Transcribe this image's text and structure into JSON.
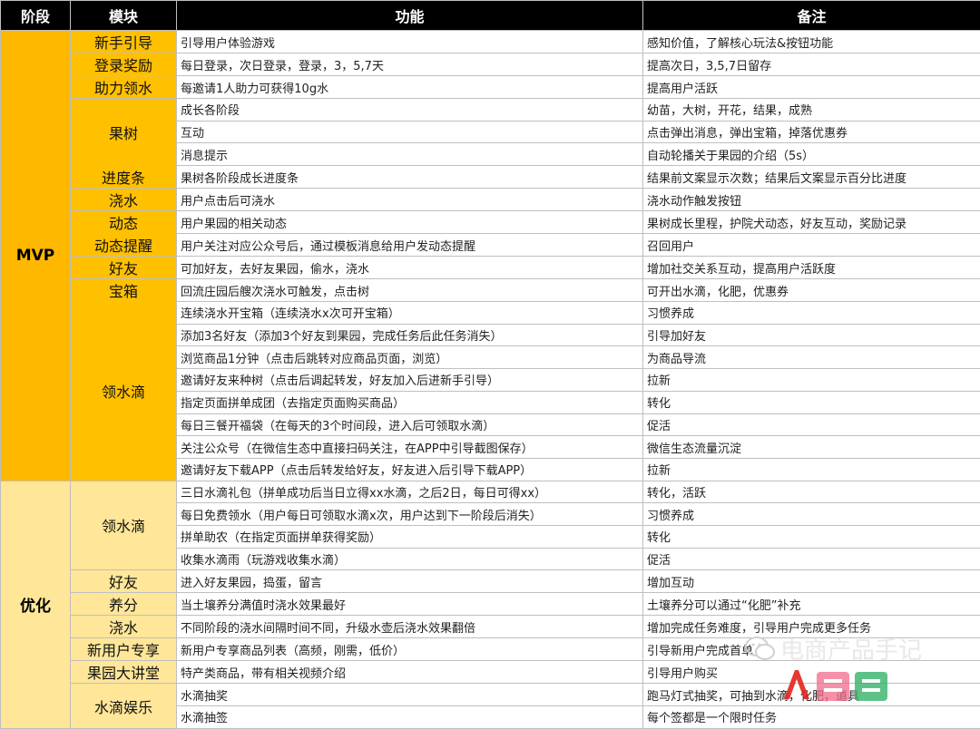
{
  "headers": {
    "stage": "阶段",
    "module": "模块",
    "function": "功能",
    "note": "备注"
  },
  "stages": {
    "mvp": "MVP",
    "opt": "优化"
  },
  "modules": {
    "m1": "新手引导",
    "m2": "登录奖励",
    "m3": "助力领水",
    "m4": "果树",
    "m5": "进度条",
    "m6": "浇水",
    "m7": "动态",
    "m8": "动态提醒",
    "m9": "好友",
    "m10": "宝箱",
    "m11": "领水滴",
    "o1": "领水滴",
    "o2": "好友",
    "o3": "养分",
    "o4": "浇水",
    "o5": "新用户专享",
    "o6": "果园大讲堂",
    "o7": "水滴娱乐"
  },
  "rows": [
    {
      "f": "引导用户体验游戏",
      "n": "感知价值，了解核心玩法&按钮功能"
    },
    {
      "f": "每日登录，次日登录，登录，3，5,7天",
      "n": "提高次日，3,5,7日留存"
    },
    {
      "f": "每邀请1人助力可获得10g水",
      "n": "提高用户活跃"
    },
    {
      "f": "成长各阶段",
      "n": "幼苗，大树，开花，结果，成熟"
    },
    {
      "f": "互动",
      "n": "点击弹出消息，弹出宝箱，掉落优惠券"
    },
    {
      "f": "消息提示",
      "n": "自动轮播关于果园的介绍（5s）"
    },
    {
      "f": "果树各阶段成长进度条",
      "n": "结果前文案显示次数；结果后文案显示百分比进度"
    },
    {
      "f": "用户点击后可浇水",
      "n": "浇水动作触发按钮"
    },
    {
      "f": "用户果园的相关动态",
      "n": "果树成长里程，护院犬动态，好友互动，奖励记录"
    },
    {
      "f": "用户关注对应公众号后，通过模板消息给用户发动态提醒",
      "n": "召回用户"
    },
    {
      "f": "可加好友，去好友果园，偷水，浇水",
      "n": "增加社交关系互动，提高用户活跃度"
    },
    {
      "f": "回流庄园后艘次浇水可触发，点击树",
      "n": "可开出水滴，化肥，优惠券"
    },
    {
      "f": "连续浇水开宝箱（连续浇水x次可开宝箱）",
      "n": "习惯养成"
    },
    {
      "f": "添加3名好友（添加3个好友到果园，完成任务后此任务消失）",
      "n": "引导加好友"
    },
    {
      "f": "浏览商品1分钟（点击后跳转对应商品页面，浏览）",
      "n": "为商品导流"
    },
    {
      "f": "邀请好友来种树（点击后调起转发，好友加入后进新手引导）",
      "n": "拉新"
    },
    {
      "f": "指定页面拼单成团（去指定页面购买商品）",
      "n": "转化"
    },
    {
      "f": "每日三餐开福袋（在每天的3个时间段，进入后可领取水滴）",
      "n": "促活"
    },
    {
      "f": "关注公众号（在微信生态中直接扫码关注，在APP中引导截图保存）",
      "n": "微信生态流量沉淀"
    },
    {
      "f": "邀请好友下载APP（点击后转发给好友，好友进入后引导下载APP）",
      "n": "拉新"
    },
    {
      "f": "三日水滴礼包（拼单成功后当日立得xx水滴，之后2日，每日可得xx）",
      "n": "转化，活跃"
    },
    {
      "f": "每日免费领水（用户每日可领取水滴x次，用户达到下一阶段后消失）",
      "n": "习惯养成"
    },
    {
      "f": "拼单助农（在指定页面拼单获得奖励）",
      "n": "转化"
    },
    {
      "f": "收集水滴雨（玩游戏收集水滴）",
      "n": "促活"
    },
    {
      "f": "进入好友果园，捣蛋，留言",
      "n": "增加互动"
    },
    {
      "f": "当土壤养分满值时浇水效果最好",
      "n": "土壤养分可以通过“化肥”补充"
    },
    {
      "f": "不同阶段的浇水间隔时间不同，升级水壶后浇水效果翻倍",
      "n": "增加完成任务难度，引导用户完成更多任务"
    },
    {
      "f": "新用户专享商品列表（高频，刚需，低价）",
      "n": "引导新用户完成首单"
    },
    {
      "f": "特产类商品，带有相关视频介绍",
      "n": "引导用户购买"
    },
    {
      "f": "水滴抽奖",
      "n": "跑马灯式抽奖，可抽到水滴，化肥，道具"
    },
    {
      "f": "水滴抽签",
      "n": "每个签都是一个限时任务"
    }
  ],
  "watermark": {
    "text": "电商产品手记",
    "icon": "wechat-icon",
    "logo": "renren-logo"
  },
  "colors": {
    "header_bg": "#000000",
    "mvp": "#ffc000",
    "opt": "#ffe699"
  }
}
